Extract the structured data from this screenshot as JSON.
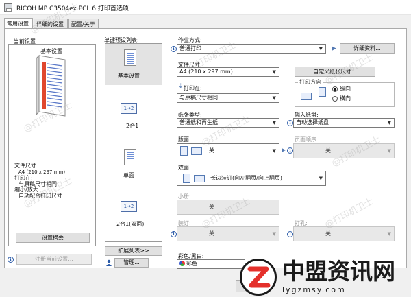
{
  "window": {
    "title": "RICOH MP C3504ex PCL 6 打印首选项"
  },
  "tabs": [
    {
      "label": "常用设置"
    },
    {
      "label": "详细的设置"
    },
    {
      "label": "配置/关于"
    }
  ],
  "left": {
    "current_settings_label": "当前设置",
    "preset_name": "基本设置",
    "summary": {
      "paper_size_label": "文件尺寸:",
      "paper_size_value": "A4 (210 x 297 mm)",
      "print_on_label": "打印在:",
      "print_on_value": "与原稿尺寸相同",
      "scale_label": "缩小/放大:",
      "scale_value": "自动配合打印尺寸"
    },
    "settings_summary_button": "设置摘要",
    "register_button": "注册当前设置..."
  },
  "presets": {
    "list_label": "单键预设列表:",
    "items": [
      {
        "label": "基本设置"
      },
      {
        "label": "2合1"
      },
      {
        "label": "单面"
      },
      {
        "label": "2合1(双面)"
      }
    ],
    "two_up_glyph": "1→2",
    "expand_button": "扩展列表>>",
    "manage_button": "管理..."
  },
  "main": {
    "job_type_label": "作业方式:",
    "job_type_value": "普通打印",
    "details_button": "详细资料...",
    "paper_size_label": "文件尺寸:",
    "paper_size_value": "A4 (210 x 297 mm)",
    "custom_size_button": "自定义纸张尺寸...",
    "print_on_label": "打印在:",
    "print_on_value": "与原稿尺寸相同",
    "orientation_label": "打印方向",
    "orientation_portrait": "纵向",
    "orientation_landscape": "横向",
    "paper_type_label": "纸张类型:",
    "paper_type_value": "普通纸和再生纸",
    "input_tray_label": "输入纸盘:",
    "input_tray_value": "自动选择纸盘",
    "layout_label": "版面:",
    "layout_value": "关",
    "page_order_label": "页面顺序:",
    "page_order_value": "关",
    "duplex_label": "双面:",
    "duplex_value": "长边装订(向左翻页/向上翻页)",
    "booklet_label": "小册:",
    "booklet_value": "关",
    "staple_label": "装订:",
    "staple_value": "关",
    "punch_label": "打孔:",
    "punch_value": "关",
    "color_label": "彩色/黑白:",
    "color_value": "彩色"
  },
  "watermark": {
    "brand": "中盟资讯网",
    "url": "lygzmsy.com",
    "faint_text": "@打印机卫士"
  }
}
